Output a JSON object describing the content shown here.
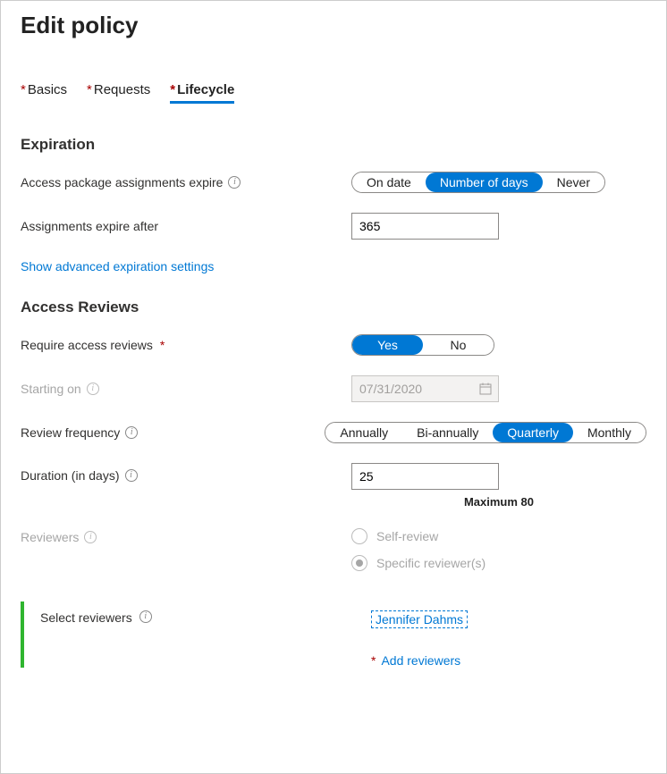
{
  "title": "Edit policy",
  "tabs": {
    "basics": "Basics",
    "requests": "Requests",
    "lifecycle": "Lifecycle"
  },
  "expiration": {
    "heading": "Expiration",
    "assignExpire": "Access package assignments expire",
    "options": {
      "ondate": "On date",
      "days": "Number of days",
      "never": "Never"
    },
    "expireAfter": "Assignments expire after",
    "expireAfterValue": "365",
    "advanced": "Show advanced expiration settings"
  },
  "reviews": {
    "heading": "Access Reviews",
    "require": "Require access reviews",
    "yes": "Yes",
    "no": "No",
    "starting": "Starting on",
    "startingValue": "07/31/2020",
    "freq": "Review frequency",
    "freqOptions": {
      "annually": "Annually",
      "bi": "Bi-annually",
      "quarterly": "Quarterly",
      "monthly": "Monthly"
    },
    "duration": "Duration (in days)",
    "durationValue": "25",
    "durationHelper": "Maximum 80",
    "reviewers": "Reviewers",
    "selfReview": "Self-review",
    "specific": "Specific reviewer(s)",
    "selectReviewers": "Select reviewers",
    "reviewerName": "Jennifer Dahms",
    "addReviewers": "Add reviewers"
  }
}
